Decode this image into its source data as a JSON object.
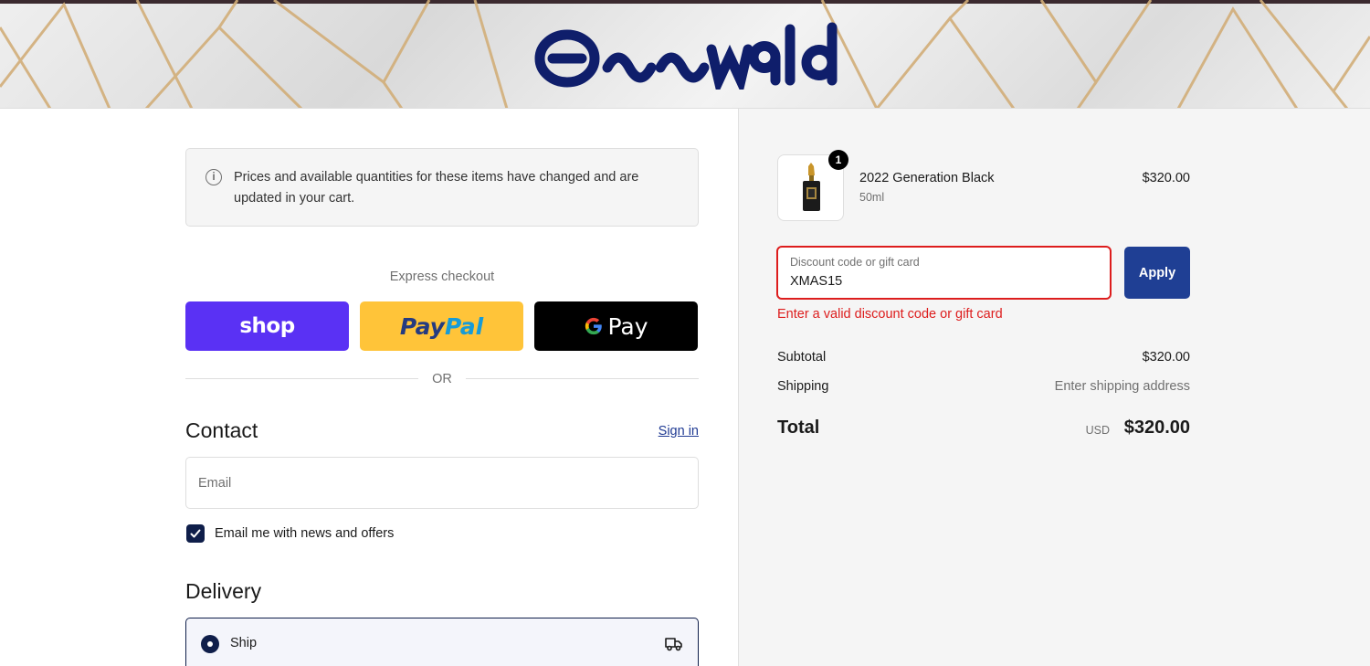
{
  "header": {
    "brand": "Osswald",
    "logo_icon": "brand-logo"
  },
  "notice": {
    "icon": "info-icon",
    "message": "Prices and available quantities for these items have changed and are updated in your cart."
  },
  "express": {
    "label": "Express checkout",
    "shop_label": "shop",
    "paypal_part1": "Pay",
    "paypal_part2": "Pal",
    "gpay_label": "Pay",
    "or_label": "OR"
  },
  "contact": {
    "title": "Contact",
    "signin_label": "Sign in",
    "email_placeholder": "Email",
    "newsletter_label": "Email me with news and offers",
    "newsletter_checked": true
  },
  "delivery": {
    "title": "Delivery",
    "ship_label": "Ship",
    "ship_icon": "truck-icon"
  },
  "order": {
    "quantity": "1",
    "product_name": "2022 Generation Black",
    "product_variant": "50ml",
    "product_price": "$320.00",
    "discount_label": "Discount code or gift card",
    "discount_value": "XMAS15",
    "apply_label": "Apply",
    "discount_error": "Enter a valid discount code or gift card",
    "subtotal_label": "Subtotal",
    "subtotal_value": "$320.00",
    "shipping_label": "Shipping",
    "shipping_value": "Enter shipping address",
    "total_label": "Total",
    "currency": "USD",
    "total_value": "$320.00"
  },
  "colors": {
    "accent": "#1f3f94",
    "error": "#dd1d1d",
    "shop_pay": "#5a31f4",
    "paypal": "#ffc439",
    "gpay": "#000000",
    "brand_navy": "#0f1e6b"
  }
}
